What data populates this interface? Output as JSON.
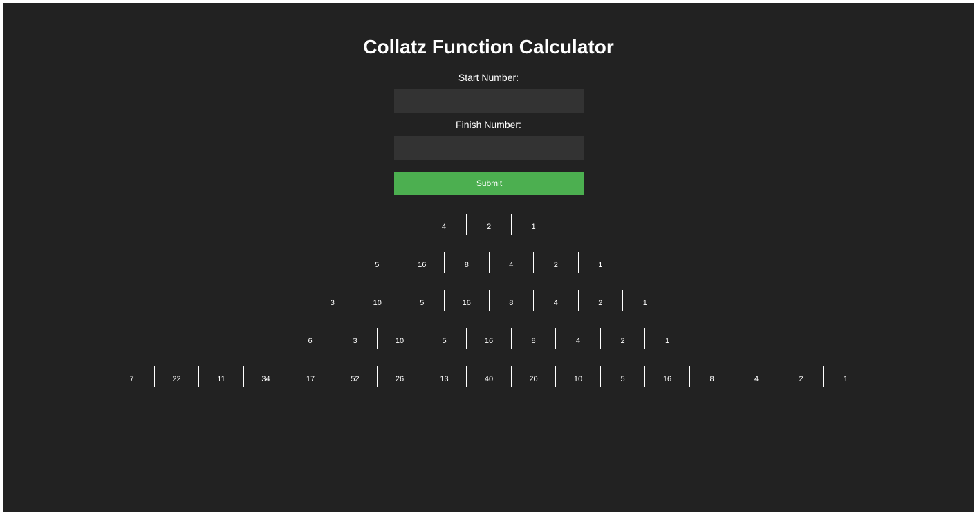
{
  "app": {
    "title": "Collatz Function Calculator"
  },
  "form": {
    "start_label": "Start Number:",
    "start_value": "",
    "finish_label": "Finish Number:",
    "finish_value": "",
    "submit_label": "Submit"
  },
  "results": [
    [
      "4",
      "2",
      "1"
    ],
    [
      "5",
      "16",
      "8",
      "4",
      "2",
      "1"
    ],
    [
      "3",
      "10",
      "5",
      "16",
      "8",
      "4",
      "2",
      "1"
    ],
    [
      "6",
      "3",
      "10",
      "5",
      "16",
      "8",
      "4",
      "2",
      "1"
    ],
    [
      "7",
      "22",
      "11",
      "34",
      "17",
      "52",
      "26",
      "13",
      "40",
      "20",
      "10",
      "5",
      "16",
      "8",
      "4",
      "2",
      "1"
    ]
  ],
  "colors": {
    "background": "#222222",
    "input_background": "#333333",
    "button_background": "#4caf50",
    "text": "#ffffff"
  }
}
